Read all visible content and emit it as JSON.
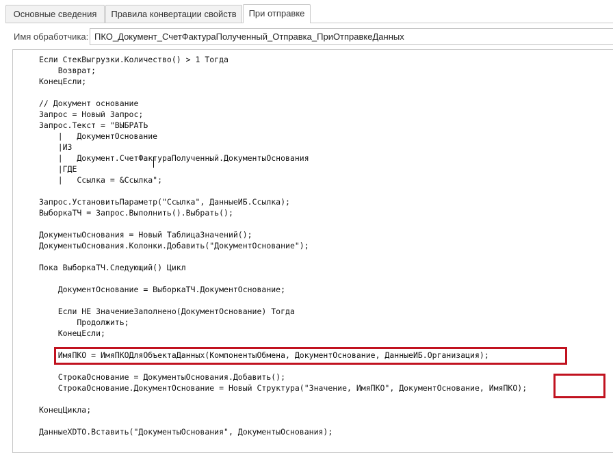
{
  "tabs": [
    {
      "label": "Основные сведения",
      "active": false
    },
    {
      "label": "Правила конвертации свойств",
      "active": false
    },
    {
      "label": "При отправке",
      "active": true
    }
  ],
  "handler": {
    "label": "Имя обработчика:",
    "value": "ПКО_Документ_СчетФактураПолученный_Отправка_ПриОтправкеДанных"
  },
  "code": {
    "lines": [
      "Если СтекВыгрузки.Количество() > 1 Тогда",
      "    Возврат;",
      "КонецЕсли;",
      "",
      "// Документ основание",
      "Запрос = Новый Запрос;",
      "Запрос.Текст = \"ВЫБРАТЬ",
      "    |   ДокументОснование",
      "    |ИЗ",
      "    |   Документ.СчетФактураПолученный.ДокументыОснования",
      "    |ГДЕ",
      "    |   Ссылка = &Ссылка\";",
      "",
      "Запрос.УстановитьПараметр(\"Ссылка\", ДанныеИБ.Ссылка);",
      "ВыборкаТЧ = Запрос.Выполнить().Выбрать();",
      "",
      "ДокументыОснования = Новый ТаблицаЗначений();",
      "ДокументыОснования.Колонки.Добавить(\"ДокументОснование\");",
      "",
      "Пока ВыборкаТЧ.Следующий() Цикл",
      "",
      "    ДокументОснование = ВыборкаТЧ.ДокументОснование;",
      "",
      "    Если НЕ ЗначениеЗаполнено(ДокументОснование) Тогда",
      "        Продолжить;",
      "    КонецЕсли;",
      "",
      "    ИмяПКО = ИмяПКОДляОбъектаДанных(КомпонентыОбмена, ДокументОснование, ДанныеИБ.Организация);",
      "",
      "    СтрокаОснование = ДокументыОснования.Добавить();",
      "    СтрокаОснование.ДокументОснование = Новый Структура(\"Значение, ИмяПКО\", ДокументОснование, ИмяПКО);",
      "",
      "КонецЦикла;",
      "",
      "ДанныеXDTO.Вставить(\"ДокументыОснования\", ДокументыОснования);"
    ]
  },
  "highlight_color": "#c1121f"
}
